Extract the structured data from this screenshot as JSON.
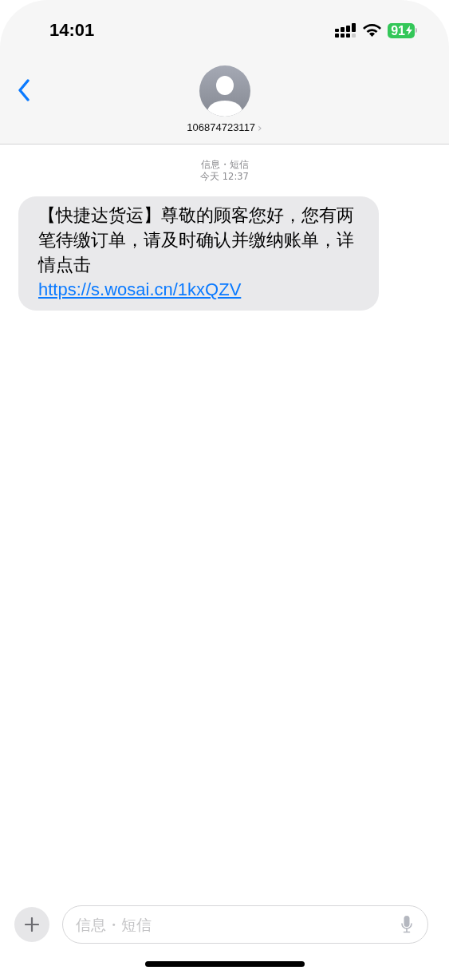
{
  "status_bar": {
    "time": "14:01",
    "battery": "91"
  },
  "header": {
    "contact": "106874723117",
    "chevron": "›"
  },
  "thread": {
    "service": "信息・短信",
    "timestamp": "今天 12:37",
    "messages": [
      {
        "text": "【快捷达货运】尊敬的顾客您好，您有两笔待缴订单，请及时确认并缴纳账单，详情点击",
        "link": "https://s.wosai.cn/1kxQZV"
      }
    ]
  },
  "composer": {
    "placeholder": "信息・短信"
  }
}
